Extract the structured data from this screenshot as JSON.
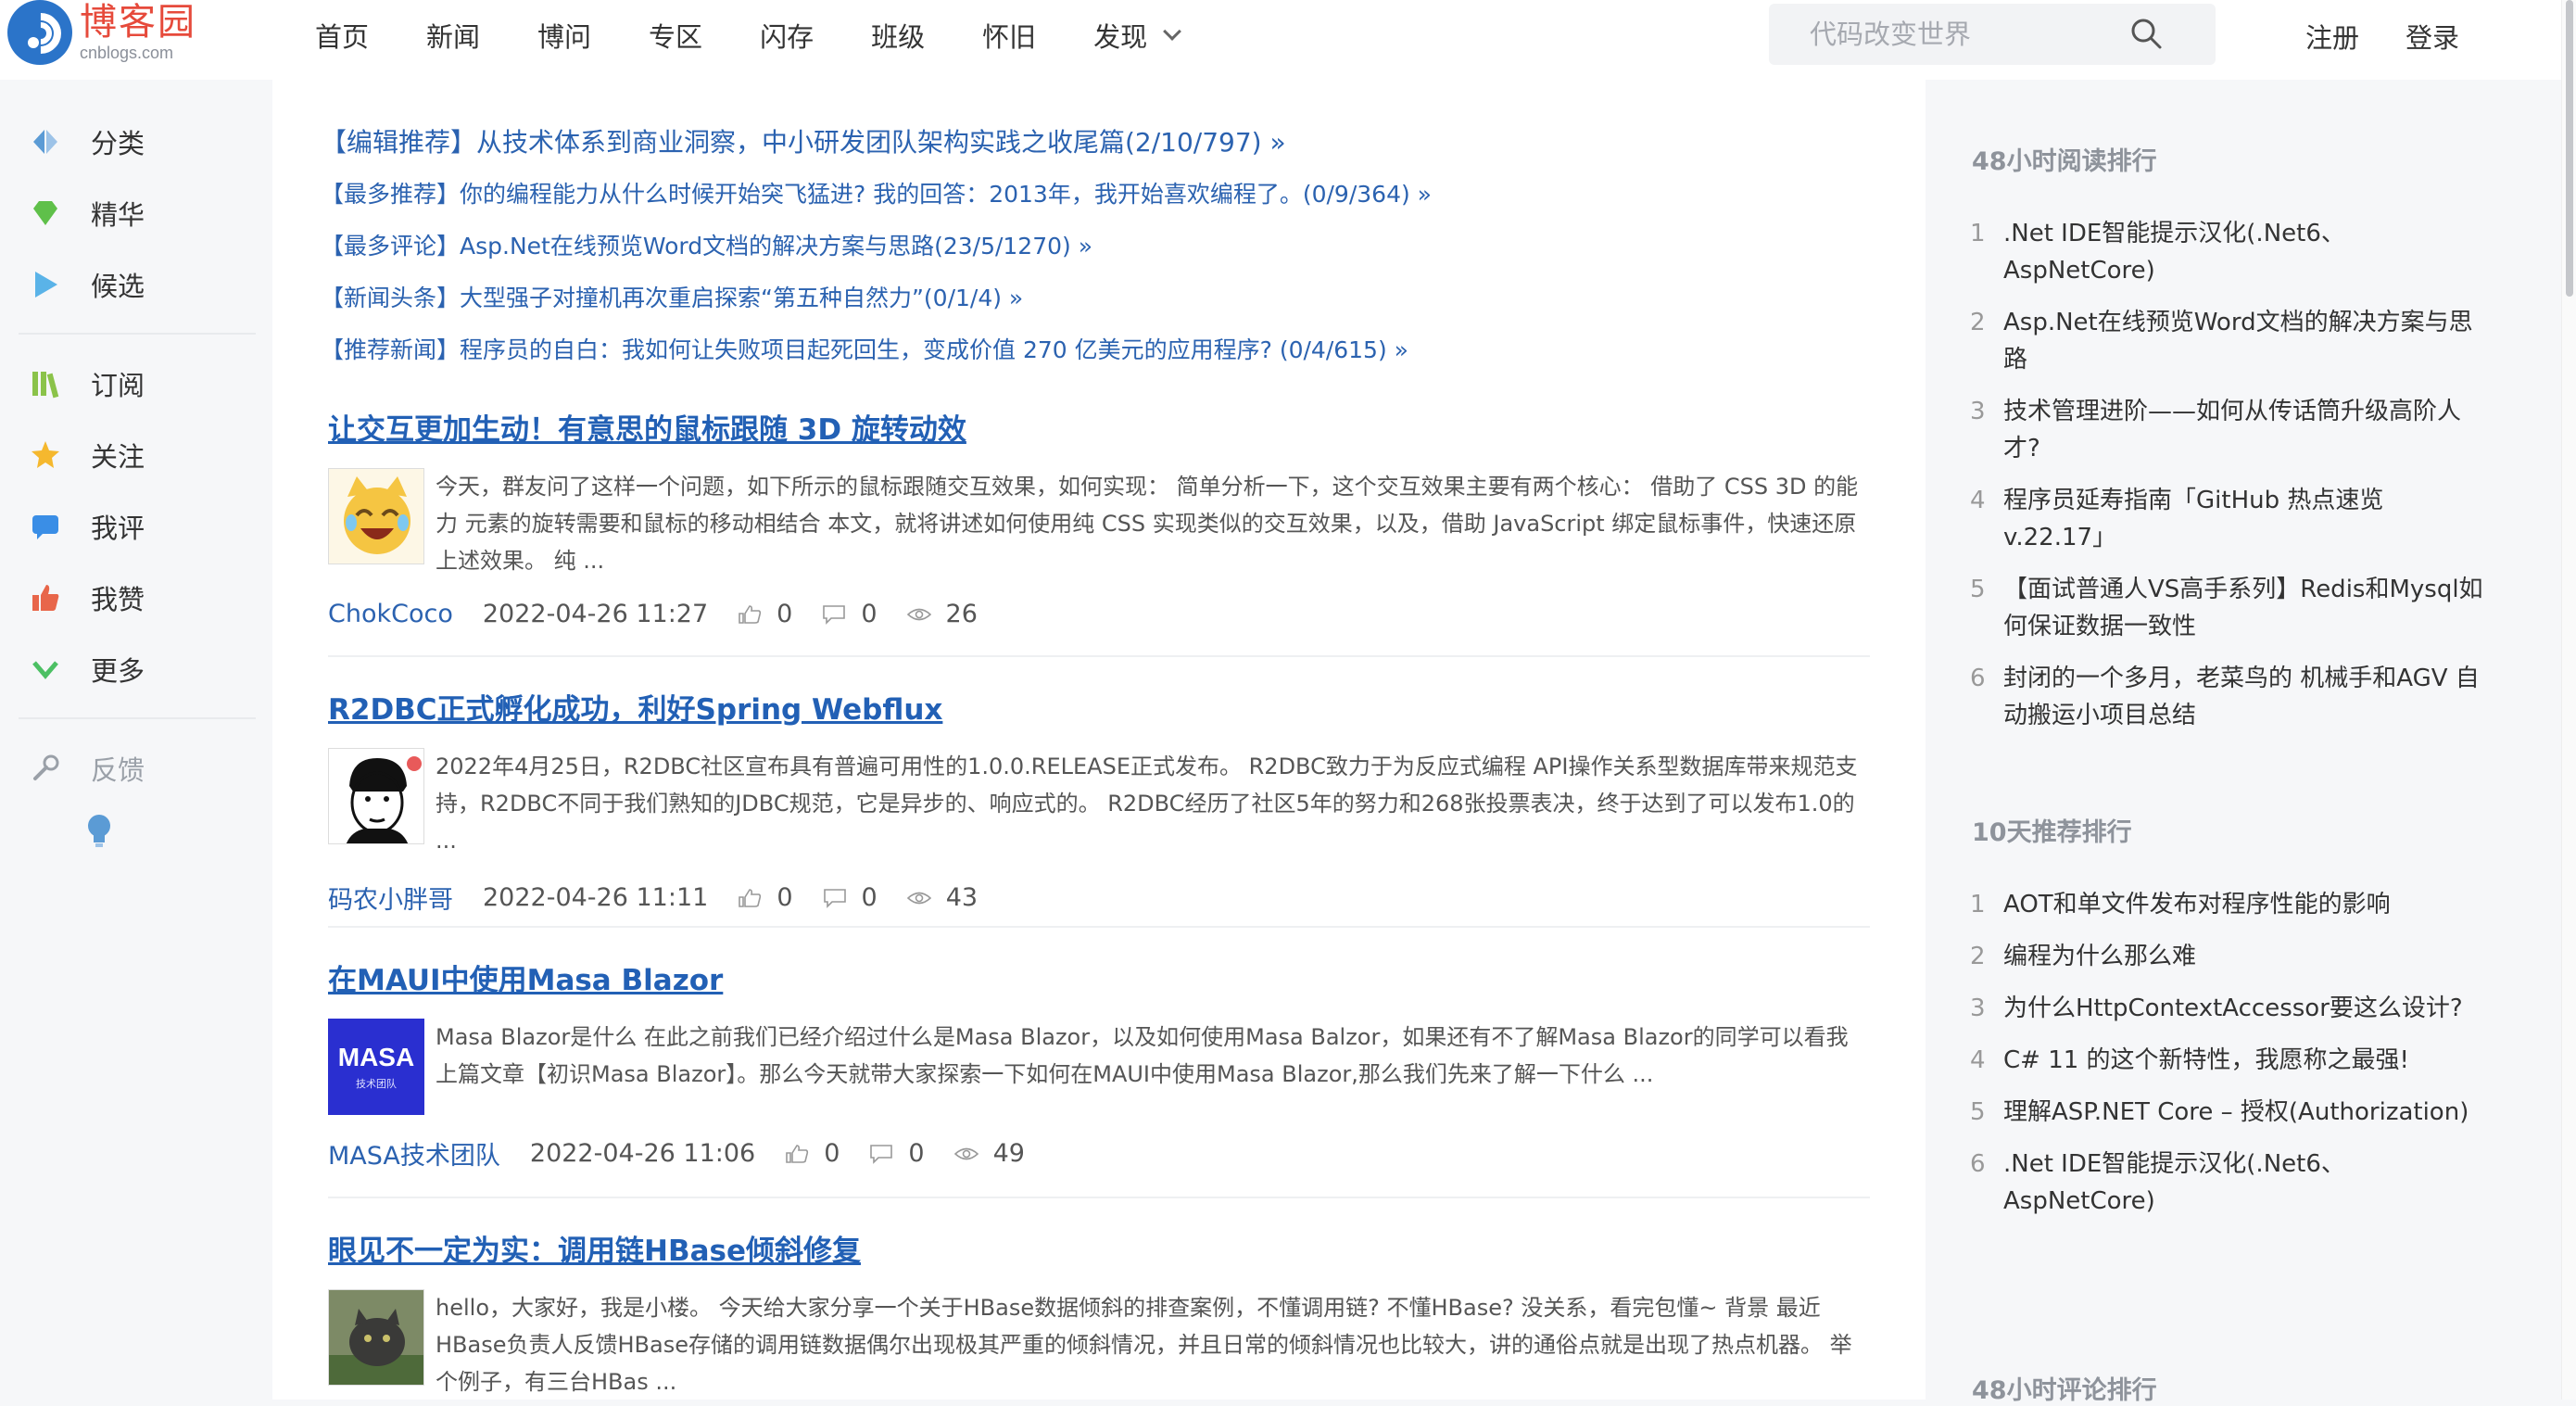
{
  "logo": {
    "name": "博客园",
    "sub": "cnblogs.com"
  },
  "nav": {
    "items": [
      "首页",
      "新闻",
      "博问",
      "专区",
      "闪存",
      "班级",
      "怀旧",
      "发现"
    ]
  },
  "search": {
    "placeholder": "代码改变世界"
  },
  "header_links": {
    "register": "注册",
    "login": "登录"
  },
  "sidebar": {
    "group1": [
      "分类",
      "精华",
      "候选"
    ],
    "group2": [
      "订阅",
      "关注",
      "我评",
      "我赞",
      "更多"
    ],
    "feedback": "反馈"
  },
  "featured": [
    "【编辑推荐】从技术体系到商业洞察，中小研发团队架构实践之收尾篇(2/10/797) »",
    "【最多推荐】你的编程能力从什么时候开始突飞猛进? 我的回答：2013年，我开始喜欢编程了。(0/9/364) »",
    "【最多评论】Asp.Net在线预览Word文档的解决方案与思路(23/5/1270) »",
    "【新闻头条】大型强子对撞机再次重启探索“第五种自然力”(0/1/4) »",
    "【推荐新闻】程序员的自白：我如何让失败项目起死回生，变成价值 270 亿美元的应用程序? (0/4/615) »"
  ],
  "posts": [
    {
      "title": "让交互更加生动！有意思的鼠标跟随 3D 旋转动效",
      "summary": "今天，群友问了这样一个问题，如下所示的鼠标跟随交互效果，如何实现： 简单分析一下，这个交互效果主要有两个核心： 借助了 CSS 3D 的能力 元素的旋转需要和鼠标的移动相结合 本文，就将讲述如何使用纯 CSS 实现类似的交互效果，以及，借助 JavaScript 绑定鼠标事件，快速还原上述效果。 纯 ...",
      "author": "ChokCoco",
      "date": "2022-04-26 11:27",
      "likes": "0",
      "comments": "0",
      "views": "26"
    },
    {
      "title": "R2DBC正式孵化成功，利好Spring Webflux",
      "summary": "2022年4月25日，R2DBC社区宣布具有普遍可用性的1.0.0.RELEASE正式发布。 R2DBC致力于为反应式编程 API操作关系型数据库带来规范支持，R2DBC不同于我们熟知的JDBC规范，它是异步的、响应式的。 R2DBC经历了社区5年的努力和268张投票表决，终于达到了可以发布1.0的 ...",
      "author": "码农小胖哥",
      "date": "2022-04-26 11:11",
      "likes": "0",
      "comments": "0",
      "views": "43"
    },
    {
      "title": "在MAUI中使用Masa Blazor",
      "summary": "Masa Blazor是什么 在此之前我们已经介绍过什么是Masa Blazor，以及如何使用Masa Balzor，如果还有不了解Masa Blazor的同学可以看我上篇文章【初识Masa Blazor】。那么今天就带大家探索一下如何在MAUI中使用Masa Blazor,那么我们先来了解一下什么 ...",
      "author": "MASA技术团队",
      "date": "2022-04-26 11:06",
      "likes": "0",
      "comments": "0",
      "views": "49",
      "thumb_text": "MASA",
      "thumb_sub": "技术团队"
    },
    {
      "title": "眼见不一定为实：调用链HBase倾斜修复",
      "summary": "hello，大家好，我是小楼。 今天给大家分享一个关于HBase数据倾斜的排查案例，不懂调用链? 不懂HBase? 没关系，看完包懂~ 背景 最近HBase负责人反馈HBase存储的调用链数据偶尔出现极其严重的倾斜情况，并且日常的倾斜情况也比较大，讲的通俗点就是出现了热点机器。 举个例子，有三台HBas ..."
    }
  ],
  "ranks": {
    "read48": {
      "title": "48小时阅读排行",
      "items": [
        ".Net IDE智能提示汉化(.Net6、AspNetCore)",
        "Asp.Net在线预览Word文档的解决方案与思路",
        "技术管理进阶——如何从传话筒升级高阶人才?",
        "程序员延寿指南「GitHub 热点速览 v.22.17」",
        "【面试普通人VS高手系列】Redis和Mysql如何保证数据一致性",
        "封闭的一个多月，老菜鸟的 机械手和AGV 自动搬运小项目总结"
      ]
    },
    "rec10": {
      "title": "10天推荐排行",
      "items": [
        "AOT和单文件发布对程序性能的影响",
        "编程为什么那么难",
        "为什么HttpContextAccessor要这么设计?",
        "C# 11 的这个新特性，我愿称之最强!",
        "理解ASP.NET Core – 授权(Authorization)",
        ".Net IDE智能提示汉化(.Net6、AspNetCore)"
      ]
    },
    "comment48": {
      "title": "48小时评论排行"
    }
  },
  "colors": {
    "brand_red": "#e64a3b",
    "link_blue": "#2b62b0",
    "logo_blue": "#2b74c9"
  }
}
